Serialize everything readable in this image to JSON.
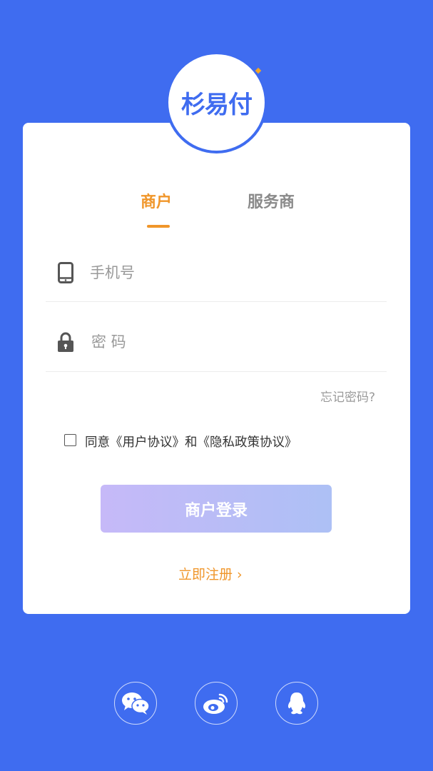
{
  "logo": {
    "text": "杉易付"
  },
  "tabs": [
    {
      "label": "商户",
      "active": true
    },
    {
      "label": "服务商",
      "active": false
    }
  ],
  "phone": {
    "placeholder": "手机号",
    "value": "",
    "icon": "phone-icon"
  },
  "password": {
    "placeholder": "密 码",
    "value": "",
    "icon": "lock-icon"
  },
  "forgot": {
    "label": "忘记密码?"
  },
  "agreement": {
    "checked": false,
    "prefix": "同意",
    "user_agreement": "《用户协议》",
    "conj": "和",
    "privacy_policy": "《隐私政策协议》"
  },
  "login": {
    "label": "商户登录"
  },
  "register": {
    "label": "立即注册 ›"
  },
  "social": [
    {
      "icon": "wechat-icon"
    },
    {
      "icon": "weibo-icon"
    },
    {
      "icon": "qq-icon"
    }
  ],
  "colors": {
    "background": "#3f6cf0",
    "accent": "#f0962a",
    "inactive_tab": "#8a8a8a",
    "button_gradient_start": "#c6b9f8",
    "button_gradient_end": "#adc0f5"
  }
}
